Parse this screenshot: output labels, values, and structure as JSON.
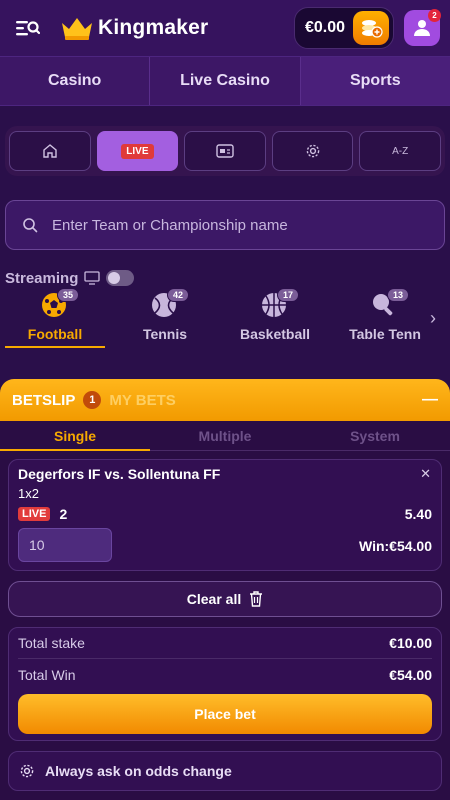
{
  "header": {
    "brand": "Kingmaker",
    "balance": "€0.00",
    "notification_count": "2"
  },
  "main_tabs": [
    "Casino",
    "Live Casino",
    "Sports"
  ],
  "filter_bar": {
    "live_label": "LIVE",
    "az_label": "A-Z"
  },
  "search": {
    "placeholder": "Enter Team or Championship name"
  },
  "streaming": {
    "label": "Streaming",
    "enabled": false
  },
  "sports": [
    {
      "name": "Football",
      "count": "35"
    },
    {
      "name": "Tennis",
      "count": "42"
    },
    {
      "name": "Basketball",
      "count": "17"
    },
    {
      "name": "Table Tenn",
      "count": "13"
    }
  ],
  "betslip": {
    "title": "BETSLIP",
    "count": "1",
    "my_bets": "MY BETS",
    "types": [
      "Single",
      "Multiple",
      "System"
    ],
    "bet": {
      "match": "Degerfors IF vs. Sollentuna FF",
      "market": "1x2",
      "live_tag": "LIVE",
      "selection": "2",
      "odds": "5.40",
      "stake": "10",
      "win": "Win:€54.00"
    },
    "clear_all": "Clear all",
    "total_stake_label": "Total stake",
    "total_stake": "€10.00",
    "total_win_label": "Total Win",
    "total_win": "€54.00",
    "place_bet": "Place bet",
    "odds_change": "Always ask on odds change"
  },
  "colors": {
    "accent": "#f7a900",
    "background": "#2a0f4a",
    "live": "#e23c3c"
  }
}
